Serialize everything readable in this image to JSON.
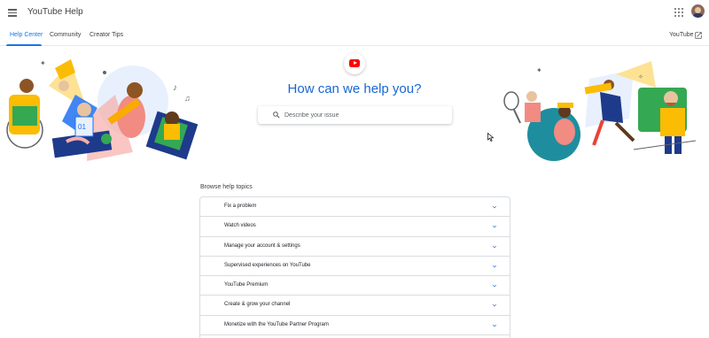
{
  "header": {
    "app_title": "YouTube Help",
    "menu_icon": "menu-icon",
    "apps_icon": "apps-grid-icon",
    "avatar_icon": "user-avatar"
  },
  "nav": {
    "tabs": [
      {
        "label": "Help Center",
        "active": true
      },
      {
        "label": "Community",
        "active": false
      },
      {
        "label": "Creator Tips",
        "active": false
      }
    ],
    "external_link": "YouTube",
    "external_icon": "open-in-new-icon"
  },
  "hero": {
    "logo_icon": "youtube-logo-icon",
    "title": "How can we help you?",
    "search": {
      "placeholder": "Describe your issue",
      "value": "",
      "icon": "search-icon"
    }
  },
  "topics": {
    "heading": "Browse help topics",
    "items": [
      {
        "label": "Fix a problem"
      },
      {
        "label": "Watch videos"
      },
      {
        "label": "Manage your account & settings"
      },
      {
        "label": "Supervised experiences on YouTube"
      },
      {
        "label": "YouTube Premium"
      },
      {
        "label": "Create & grow your channel"
      },
      {
        "label": "Monetize with the YouTube Partner Program"
      },
      {
        "label": ""
      }
    ],
    "expand_icon": "chevron-down-icon"
  },
  "colors": {
    "accent": "#1a73e8",
    "title": "#1967d2",
    "brand_red": "#ff0000",
    "divider": "#dadce0"
  }
}
